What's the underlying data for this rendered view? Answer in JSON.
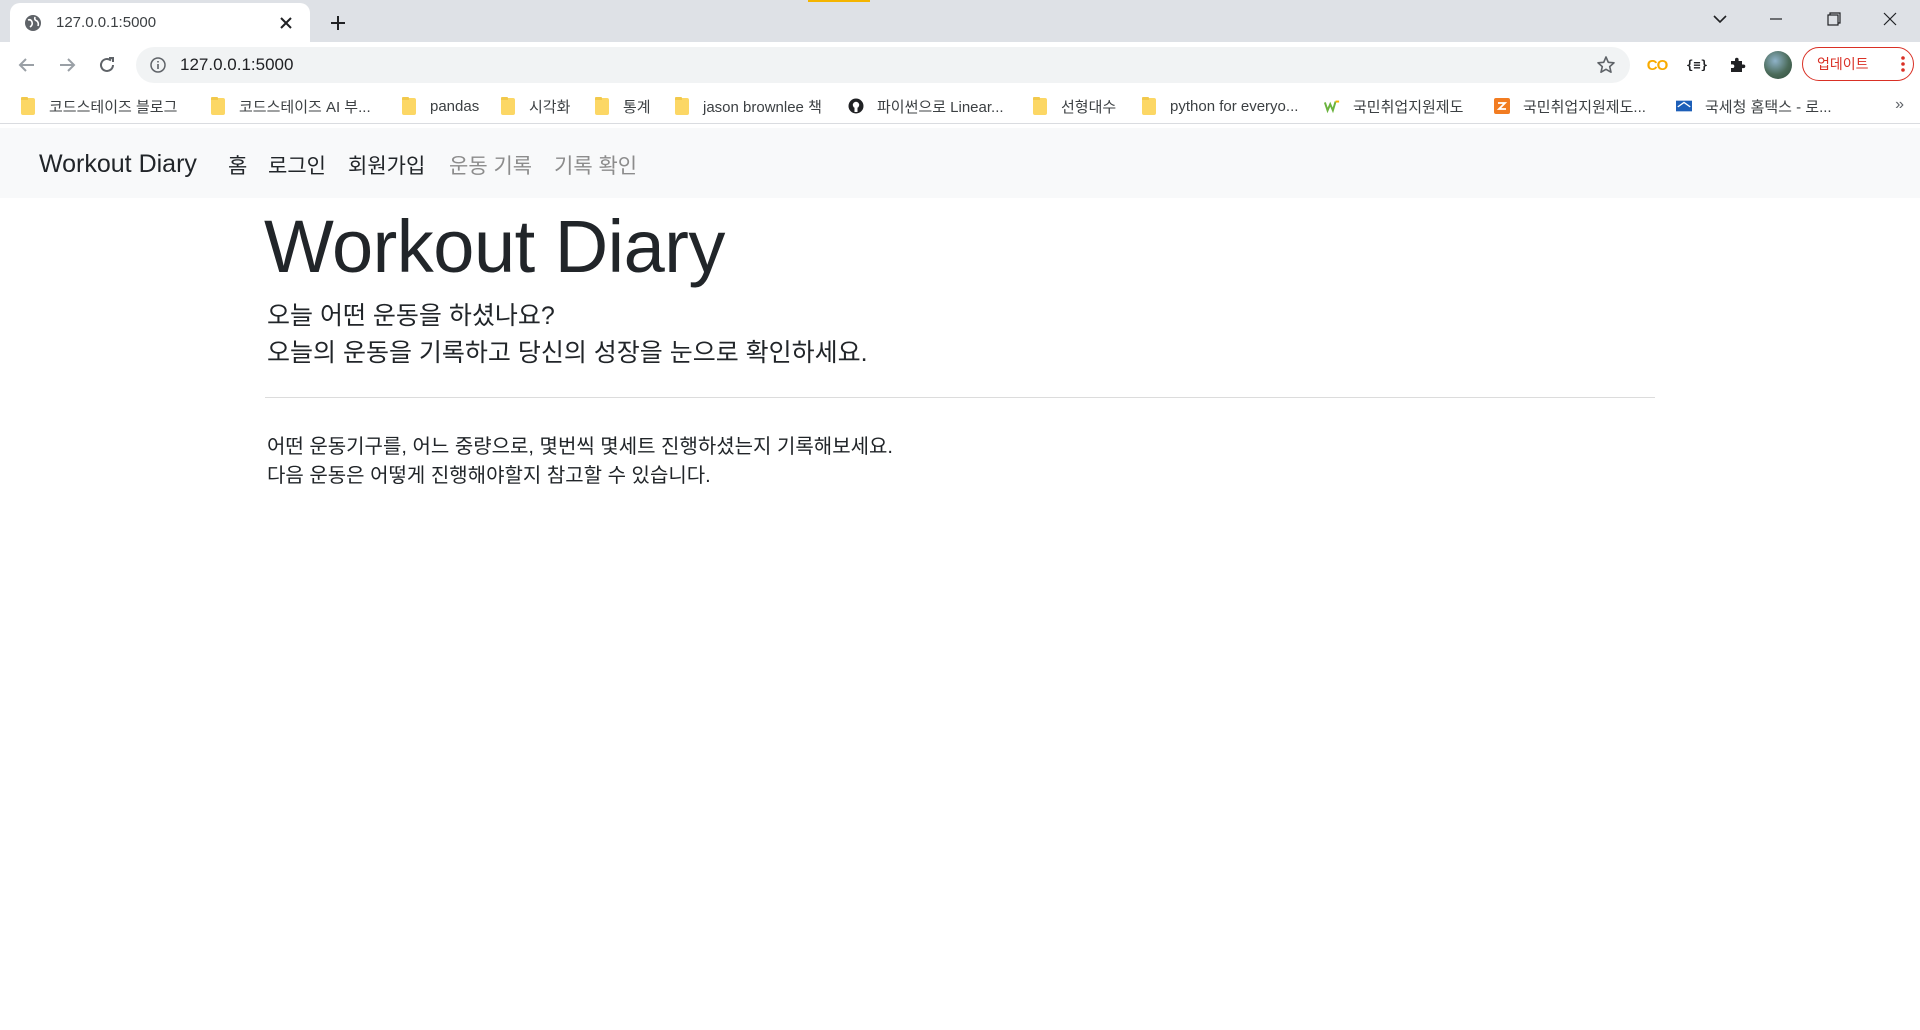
{
  "browser": {
    "tab": {
      "title": "127.0.0.1:5000"
    },
    "address_bar": {
      "url": "127.0.0.1:5000"
    },
    "update_button": {
      "label": "업데이트"
    },
    "bookmarks": [
      {
        "label": "코드스테이즈 블로그",
        "icon": "folder-icon"
      },
      {
        "label": "코드스테이즈 AI 부...",
        "icon": "folder-icon"
      },
      {
        "label": "pandas",
        "icon": "folder-icon"
      },
      {
        "label": "시각화",
        "icon": "folder-icon"
      },
      {
        "label": "통계",
        "icon": "folder-icon"
      },
      {
        "label": "jason brownlee 책",
        "icon": "folder-icon"
      },
      {
        "label": "파이썬으로 Linear...",
        "icon": "github-icon"
      },
      {
        "label": "선형대수",
        "icon": "folder-icon"
      },
      {
        "label": "python for everyo...",
        "icon": "folder-icon"
      },
      {
        "label": "국민취업지원제도",
        "icon": "worknet-icon"
      },
      {
        "label": "국민취업지원제도...",
        "icon": "site-icon"
      },
      {
        "label": "국세청 홈택스 - 로...",
        "icon": "hometax-icon"
      }
    ],
    "bookmarks_overflow": "»"
  },
  "navbar": {
    "brand": "Workout Diary",
    "links": [
      {
        "label": "홈",
        "state": "active"
      },
      {
        "label": "로그인",
        "state": "active"
      },
      {
        "label": "회원가입",
        "state": "active"
      },
      {
        "label": "운동 기록",
        "state": "muted"
      },
      {
        "label": "기록 확인",
        "state": "muted"
      }
    ]
  },
  "hero": {
    "title": "Workout Diary",
    "lead_line1": "오늘 어떤 운동을 하셨나요?",
    "lead_line2": "오늘의 운동을 기록하고 당신의 성장을 눈으로 확인하세요.",
    "body_line1": "어떤 운동기구를, 어느 중량으로, 몇번씩 몇세트 진행하셨는지 기록해보세요.",
    "body_line2": "다음 운동은 어떻게 진행해야할지 참고할 수 있습니다."
  },
  "colors": {
    "chrome_bg": "#dee1e6",
    "navbar_bg": "#f8f9fa",
    "update_red": "#d93025",
    "muted_link": "#8c8c8c"
  }
}
